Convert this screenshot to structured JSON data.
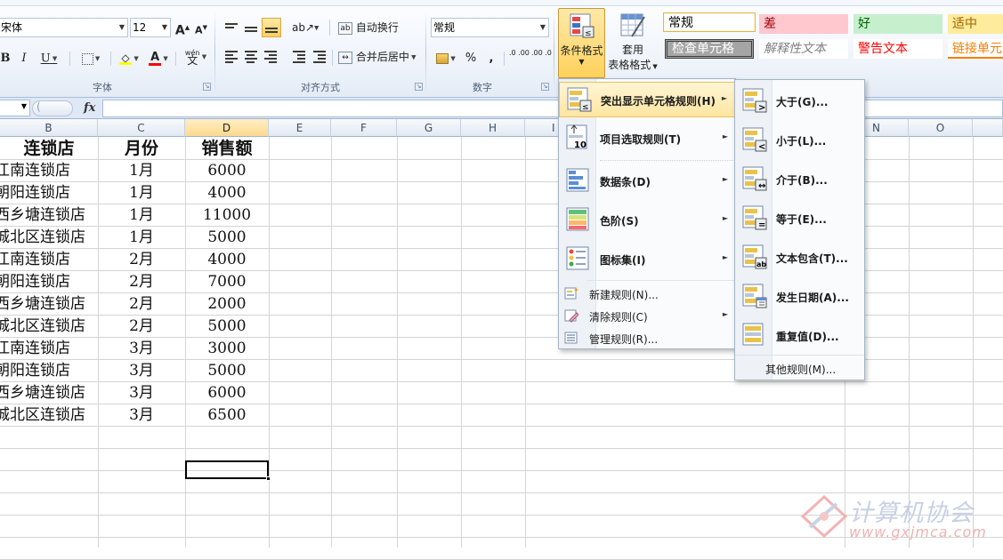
{
  "ribbon": {
    "font": {
      "font_name": "宋体",
      "font_size": "12",
      "grow_icon": "A",
      "shrink_icon": "A",
      "bold": "B",
      "italic": "I",
      "underline": "U",
      "wen": "wén",
      "group_label": "字体"
    },
    "alignment": {
      "wrap_text": "自动换行",
      "merge_center": "合并后居中",
      "group_label": "对齐方式"
    },
    "number": {
      "format": "常规",
      "percent": "%",
      "comma": ",",
      "inc_decimal": ".0 .00",
      "dec_decimal": ".00 .0",
      "group_label": "数字"
    },
    "styles": {
      "conditional_formatting": "条件格式",
      "format_as_table_1": "套用",
      "format_as_table_2": "表格格式",
      "cell_styles": [
        {
          "label": "常规",
          "bg": "#ffffff",
          "fg": "#000000"
        },
        {
          "label": "差",
          "bg": "#ffc7ce",
          "fg": "#9c0006"
        },
        {
          "label": "好",
          "bg": "#c6efce",
          "fg": "#006100"
        },
        {
          "label": "适中",
          "bg": "#ffeb9c",
          "fg": "#9c6500"
        },
        {
          "label": "检查单元格",
          "bg": "#a5a5a5",
          "fg": "#ffffff"
        },
        {
          "label": "解释性文本",
          "bg": "#ffffff",
          "fg": "#7f7f7f"
        },
        {
          "label": "警告文本",
          "bg": "#ffffff",
          "fg": "#ff0000"
        },
        {
          "label": "链接单元",
          "bg": "#ffffff",
          "fg": "#fa7d00"
        }
      ]
    }
  },
  "formula_bar": {
    "name_box": "",
    "fx": "fx",
    "content": ""
  },
  "columns": [
    "B",
    "C",
    "D",
    "E",
    "F",
    "G",
    "H",
    "I",
    "N",
    "O"
  ],
  "sheet": {
    "header": [
      "连锁店",
      "月份",
      "销售额"
    ],
    "rows": [
      [
        "江南连锁店",
        "1月",
        "6000"
      ],
      [
        "朝阳连锁店",
        "1月",
        "4000"
      ],
      [
        "西乡塘连锁店",
        "1月",
        "11000"
      ],
      [
        "城北区连锁店",
        "1月",
        "5000"
      ],
      [
        "江南连锁店",
        "2月",
        "4000"
      ],
      [
        "朝阳连锁店",
        "2月",
        "7000"
      ],
      [
        "西乡塘连锁店",
        "2月",
        "2000"
      ],
      [
        "城北区连锁店",
        "2月",
        "5000"
      ],
      [
        "江南连锁店",
        "3月",
        "3000"
      ],
      [
        "朝阳连锁店",
        "3月",
        "5000"
      ],
      [
        "西乡塘连锁店",
        "3月",
        "6000"
      ],
      [
        "城北区连锁店",
        "3月",
        "6500"
      ]
    ]
  },
  "cf_menu": {
    "items": [
      {
        "label": "突出显示单元格规则(H)",
        "hot": true
      },
      {
        "label": "项目选取规则(T)"
      },
      {
        "label": "数据条(D)"
      },
      {
        "label": "色阶(S)"
      },
      {
        "label": "图标集(I)"
      }
    ],
    "small_items": [
      {
        "label": "新建规则(N)..."
      },
      {
        "label": "清除规则(C)"
      },
      {
        "label": "管理规则(R)..."
      }
    ]
  },
  "submenu": {
    "items": [
      {
        "label": "大于(G)..."
      },
      {
        "label": "小于(L)..."
      },
      {
        "label": "介于(B)..."
      },
      {
        "label": "等于(E)..."
      },
      {
        "label": "文本包含(T)..."
      },
      {
        "label": "发生日期(A)..."
      },
      {
        "label": "重复值(D)..."
      }
    ],
    "more": "其他规则(M)..."
  },
  "watermark": {
    "title": "计算机协会",
    "url": "www.gxjmca.com"
  }
}
